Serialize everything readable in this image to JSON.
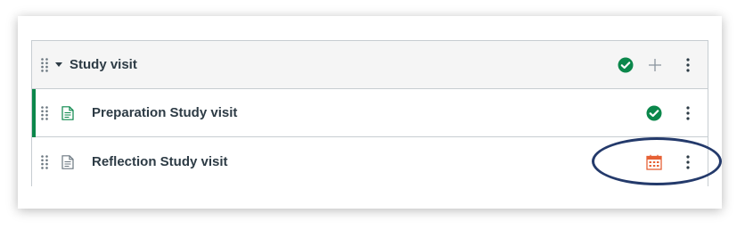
{
  "module": {
    "title": "Study visit",
    "status": "published",
    "icons": {
      "drag": "drag-handle-icon",
      "collapse": "caret-down-icon",
      "published": "check-circle-icon",
      "add": "plus-icon",
      "menu": "kebab-menu-icon"
    }
  },
  "items": [
    {
      "title": "Preparation Study visit",
      "type_icon": "document-icon",
      "status": "published",
      "status_icon": "check-circle-icon"
    },
    {
      "title": "Reflection Study visit",
      "type_icon": "document-icon",
      "status": "scheduled",
      "status_icon": "calendar-icon"
    }
  ],
  "annotation": {
    "shape": "oval",
    "color": "#243a6b"
  },
  "colors": {
    "published_green": "#0b874b",
    "calendar_orange": "#e66135",
    "text": "#2d3b45",
    "border": "#c7cdd1",
    "header_bg": "#f5f5f5"
  }
}
